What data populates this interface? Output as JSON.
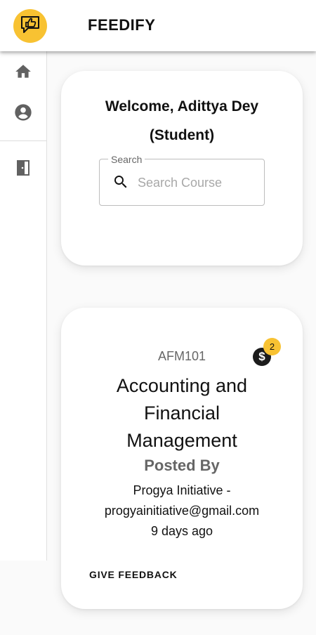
{
  "appbar": {
    "brand": "FEEDIFY",
    "logo_icon": "thumbs-up-chat-icon",
    "accent": "#f8c232"
  },
  "nav": [
    {
      "icon": "home-icon"
    },
    {
      "icon": "account-icon"
    },
    {
      "icon": "exit-door-icon"
    }
  ],
  "welcome": {
    "line1": "Welcome, Adittya Dey",
    "line2": "(Student)"
  },
  "search": {
    "label": "Search",
    "placeholder": "Search Course",
    "value": ""
  },
  "courses": [
    {
      "code": "AFM101",
      "badge_count": "2",
      "badge_icon": "dollar-coin-icon",
      "title_lines": [
        "Accounting and",
        "Financial",
        "Management"
      ],
      "posted_label": "Posted By",
      "poster_line1": "Progya Initiative -",
      "poster_line2": "progyainitiative@gmail.com",
      "time_ago": "9 days ago",
      "action_label": "GIVE FEEDBACK"
    }
  ]
}
